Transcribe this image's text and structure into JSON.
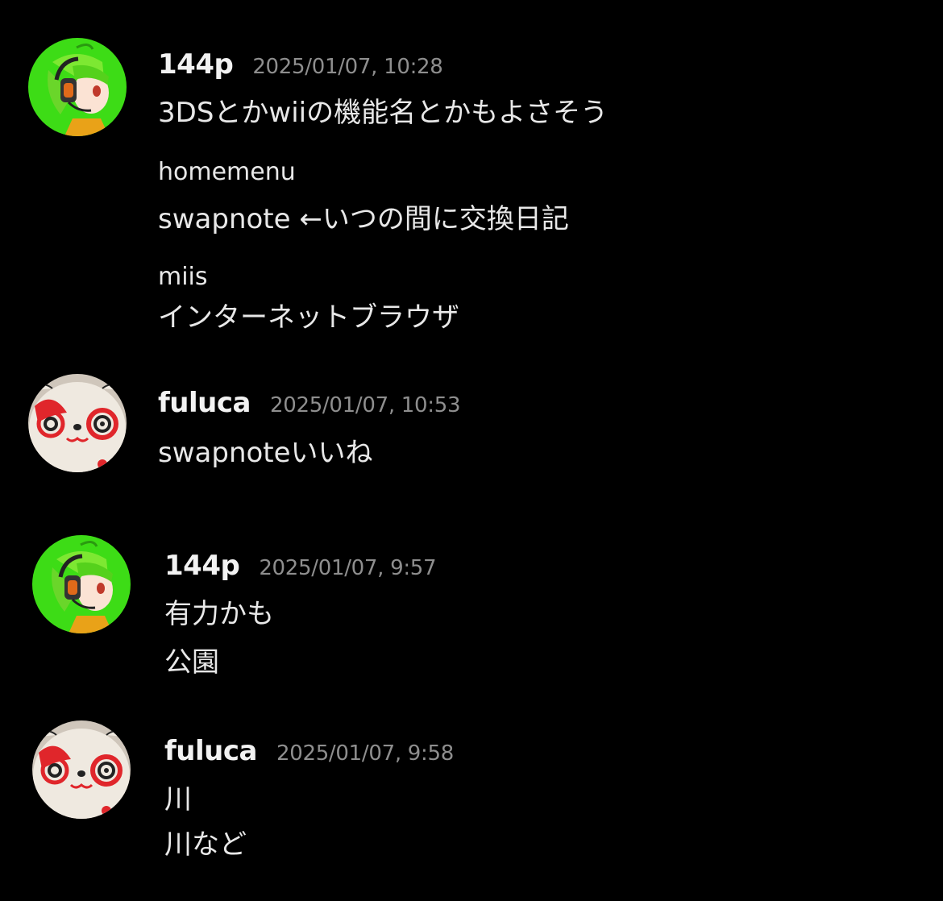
{
  "colors": {
    "background": "#000000",
    "username": "#f2f2f2",
    "timestamp": "#8e8e8e",
    "message_text": "#e8e8e8",
    "avatar_green": "#3ddc16",
    "avatar_cream": "#ece5db",
    "avatar_red": "#e0262b"
  },
  "messages": [
    {
      "username": "144p",
      "timestamp": "2025/01/07, 10:28",
      "avatar_icon": "green-hair-character-avatar-icon",
      "lines": [
        "3DSとかwiiの機能名とかもよさそう",
        "homemenu",
        "swapnote ←いつの間に交換日記",
        "miis",
        "インターネットブラウザ"
      ]
    },
    {
      "username": "fuluca",
      "timestamp": "2025/01/07, 10:53",
      "avatar_icon": "swirl-panda-avatar-icon",
      "lines": [
        "swapnoteいいね"
      ]
    },
    {
      "username": "144p",
      "timestamp": "2025/01/07, 9:57",
      "avatar_icon": "green-hair-character-avatar-icon",
      "lines": [
        "有力かも",
        "公園"
      ]
    },
    {
      "username": "fuluca",
      "timestamp": "2025/01/07, 9:58",
      "avatar_icon": "swirl-panda-avatar-icon",
      "lines": [
        "川",
        "川など"
      ]
    }
  ]
}
